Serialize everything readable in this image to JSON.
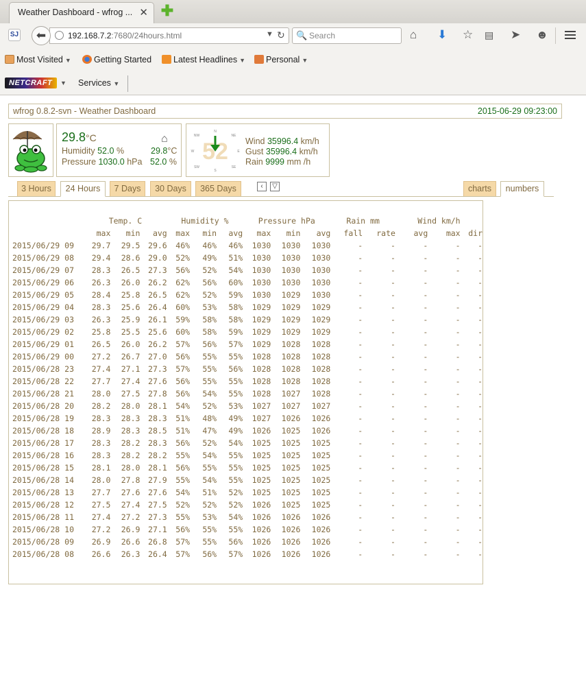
{
  "browser": {
    "tab_title": "Weather Dashboard - wfrog ...",
    "url_host": "192.168.7.2",
    "url_port_path": ":7680/24hours.html",
    "search_placeholder": "Search",
    "bookmarks": [
      {
        "label": "Most Visited",
        "icon": "most-visited-icon",
        "dropdown": true
      },
      {
        "label": "Getting Started",
        "icon": "firefox-icon",
        "dropdown": false
      },
      {
        "label": "Latest Headlines",
        "icon": "rss-icon",
        "dropdown": true
      },
      {
        "label": "Personal",
        "icon": "folder-icon",
        "dropdown": true
      }
    ],
    "netcraft_label": "NETCRAFT",
    "services_label": "Services"
  },
  "header": {
    "app_title": "wfrog 0.8.2-svn - Weather Dashboard",
    "datetime": "2015-06-29 09:23:00"
  },
  "current": {
    "temp": "29.8",
    "temp_unit": "°C",
    "humidity_label": "Humidity",
    "humidity": "52.0",
    "humidity_unit": "%",
    "pressure_label": "Pressure",
    "pressure": "1030.0",
    "pressure_unit": "hPa",
    "indoor_temp": "29.8",
    "indoor_temp_unit": "°C",
    "indoor_humidity": "52.0",
    "indoor_humidity_unit": "%"
  },
  "wind": {
    "compass": {
      "n": "N",
      "ne": "NE",
      "e": "E",
      "se": "SE",
      "s": "S",
      "sw": "SW",
      "w": "W",
      "nw": "NW"
    },
    "speed_big": "52",
    "wind_label": "Wind",
    "wind": "35996.4",
    "wind_unit": "km/h",
    "gust_label": "Gust",
    "gust": "35996.4",
    "gust_unit": "km/h",
    "rain_label": "Rain",
    "rain": "9999",
    "rain_unit": "mm /h"
  },
  "tabs": {
    "periods": [
      "3 Hours",
      "24 Hours",
      "7 Days",
      "30 Days",
      "365 Days"
    ],
    "active_period": "24 Hours",
    "prev": "‹",
    "down": "▽",
    "views": [
      "charts",
      "numbers"
    ],
    "active_view": "numbers"
  },
  "table": {
    "groups": [
      "Temp. C",
      "Humidity %",
      "Pressure hPa",
      "Rain mm",
      "Wind km/h"
    ],
    "subheaders": [
      "max",
      "min",
      "avg",
      "max",
      "min",
      "avg",
      "max",
      "min",
      "avg",
      "fall",
      "rate",
      "avg",
      "max",
      "dir"
    ],
    "rows": [
      [
        "2015/06/29 09",
        "29.7",
        "29.5",
        "29.6",
        "46%",
        "46%",
        "46%",
        "1030",
        "1030",
        "1030",
        "-",
        "-",
        "-",
        "-",
        "-"
      ],
      [
        "2015/06/29 08",
        "29.4",
        "28.6",
        "29.0",
        "52%",
        "49%",
        "51%",
        "1030",
        "1030",
        "1030",
        "-",
        "-",
        "-",
        "-",
        "-"
      ],
      [
        "2015/06/29 07",
        "28.3",
        "26.5",
        "27.3",
        "56%",
        "52%",
        "54%",
        "1030",
        "1030",
        "1030",
        "-",
        "-",
        "-",
        "-",
        "-"
      ],
      [
        "2015/06/29 06",
        "26.3",
        "26.0",
        "26.2",
        "62%",
        "56%",
        "60%",
        "1030",
        "1030",
        "1030",
        "-",
        "-",
        "-",
        "-",
        "-"
      ],
      [
        "2015/06/29 05",
        "28.4",
        "25.8",
        "26.5",
        "62%",
        "52%",
        "59%",
        "1030",
        "1029",
        "1030",
        "-",
        "-",
        "-",
        "-",
        "-"
      ],
      [
        "2015/06/29 04",
        "28.3",
        "25.6",
        "26.4",
        "60%",
        "53%",
        "58%",
        "1029",
        "1029",
        "1029",
        "-",
        "-",
        "-",
        "-",
        "-"
      ],
      [
        "2015/06/29 03",
        "26.3",
        "25.9",
        "26.1",
        "59%",
        "58%",
        "58%",
        "1029",
        "1029",
        "1029",
        "-",
        "-",
        "-",
        "-",
        "-"
      ],
      [
        "2015/06/29 02",
        "25.8",
        "25.5",
        "25.6",
        "60%",
        "58%",
        "59%",
        "1029",
        "1029",
        "1029",
        "-",
        "-",
        "-",
        "-",
        "-"
      ],
      [
        "2015/06/29 01",
        "26.5",
        "26.0",
        "26.2",
        "57%",
        "56%",
        "57%",
        "1029",
        "1028",
        "1028",
        "-",
        "-",
        "-",
        "-",
        "-"
      ],
      [
        "2015/06/29 00",
        "27.2",
        "26.7",
        "27.0",
        "56%",
        "55%",
        "55%",
        "1028",
        "1028",
        "1028",
        "-",
        "-",
        "-",
        "-",
        "-"
      ],
      [
        "2015/06/28 23",
        "27.4",
        "27.1",
        "27.3",
        "57%",
        "55%",
        "56%",
        "1028",
        "1028",
        "1028",
        "-",
        "-",
        "-",
        "-",
        "-"
      ],
      [
        "2015/06/28 22",
        "27.7",
        "27.4",
        "27.6",
        "56%",
        "55%",
        "55%",
        "1028",
        "1028",
        "1028",
        "-",
        "-",
        "-",
        "-",
        "-"
      ],
      [
        "2015/06/28 21",
        "28.0",
        "27.5",
        "27.8",
        "56%",
        "54%",
        "55%",
        "1028",
        "1027",
        "1028",
        "-",
        "-",
        "-",
        "-",
        "-"
      ],
      [
        "2015/06/28 20",
        "28.2",
        "28.0",
        "28.1",
        "54%",
        "52%",
        "53%",
        "1027",
        "1027",
        "1027",
        "-",
        "-",
        "-",
        "-",
        "-"
      ],
      [
        "2015/06/28 19",
        "28.3",
        "28.3",
        "28.3",
        "51%",
        "48%",
        "49%",
        "1027",
        "1026",
        "1026",
        "-",
        "-",
        "-",
        "-",
        "-"
      ],
      [
        "2015/06/28 18",
        "28.9",
        "28.3",
        "28.5",
        "51%",
        "47%",
        "49%",
        "1026",
        "1025",
        "1026",
        "-",
        "-",
        "-",
        "-",
        "-"
      ],
      [
        "2015/06/28 17",
        "28.3",
        "28.2",
        "28.3",
        "56%",
        "52%",
        "54%",
        "1025",
        "1025",
        "1025",
        "-",
        "-",
        "-",
        "-",
        "-"
      ],
      [
        "2015/06/28 16",
        "28.3",
        "28.2",
        "28.2",
        "55%",
        "54%",
        "55%",
        "1025",
        "1025",
        "1025",
        "-",
        "-",
        "-",
        "-",
        "-"
      ],
      [
        "2015/06/28 15",
        "28.1",
        "28.0",
        "28.1",
        "56%",
        "55%",
        "55%",
        "1025",
        "1025",
        "1025",
        "-",
        "-",
        "-",
        "-",
        "-"
      ],
      [
        "2015/06/28 14",
        "28.0",
        "27.8",
        "27.9",
        "55%",
        "54%",
        "55%",
        "1025",
        "1025",
        "1025",
        "-",
        "-",
        "-",
        "-",
        "-"
      ],
      [
        "2015/06/28 13",
        "27.7",
        "27.6",
        "27.6",
        "54%",
        "51%",
        "52%",
        "1025",
        "1025",
        "1025",
        "-",
        "-",
        "-",
        "-",
        "-"
      ],
      [
        "2015/06/28 12",
        "27.5",
        "27.4",
        "27.5",
        "52%",
        "52%",
        "52%",
        "1026",
        "1025",
        "1025",
        "-",
        "-",
        "-",
        "-",
        "-"
      ],
      [
        "2015/06/28 11",
        "27.4",
        "27.2",
        "27.3",
        "55%",
        "53%",
        "54%",
        "1026",
        "1026",
        "1026",
        "-",
        "-",
        "-",
        "-",
        "-"
      ],
      [
        "2015/06/28 10",
        "27.2",
        "26.9",
        "27.1",
        "56%",
        "55%",
        "55%",
        "1026",
        "1026",
        "1026",
        "-",
        "-",
        "-",
        "-",
        "-"
      ],
      [
        "2015/06/28 09",
        "26.9",
        "26.6",
        "26.8",
        "57%",
        "55%",
        "56%",
        "1026",
        "1026",
        "1026",
        "-",
        "-",
        "-",
        "-",
        "-"
      ],
      [
        "2015/06/28 08",
        "26.6",
        "26.3",
        "26.4",
        "57%",
        "56%",
        "57%",
        "1026",
        "1026",
        "1026",
        "-",
        "-",
        "-",
        "-",
        "-"
      ]
    ]
  },
  "colors": {
    "label": "#806a40",
    "value": "#1a6e1a",
    "tab_bg": "#f5d9a8",
    "border": "#c9c0a0"
  }
}
